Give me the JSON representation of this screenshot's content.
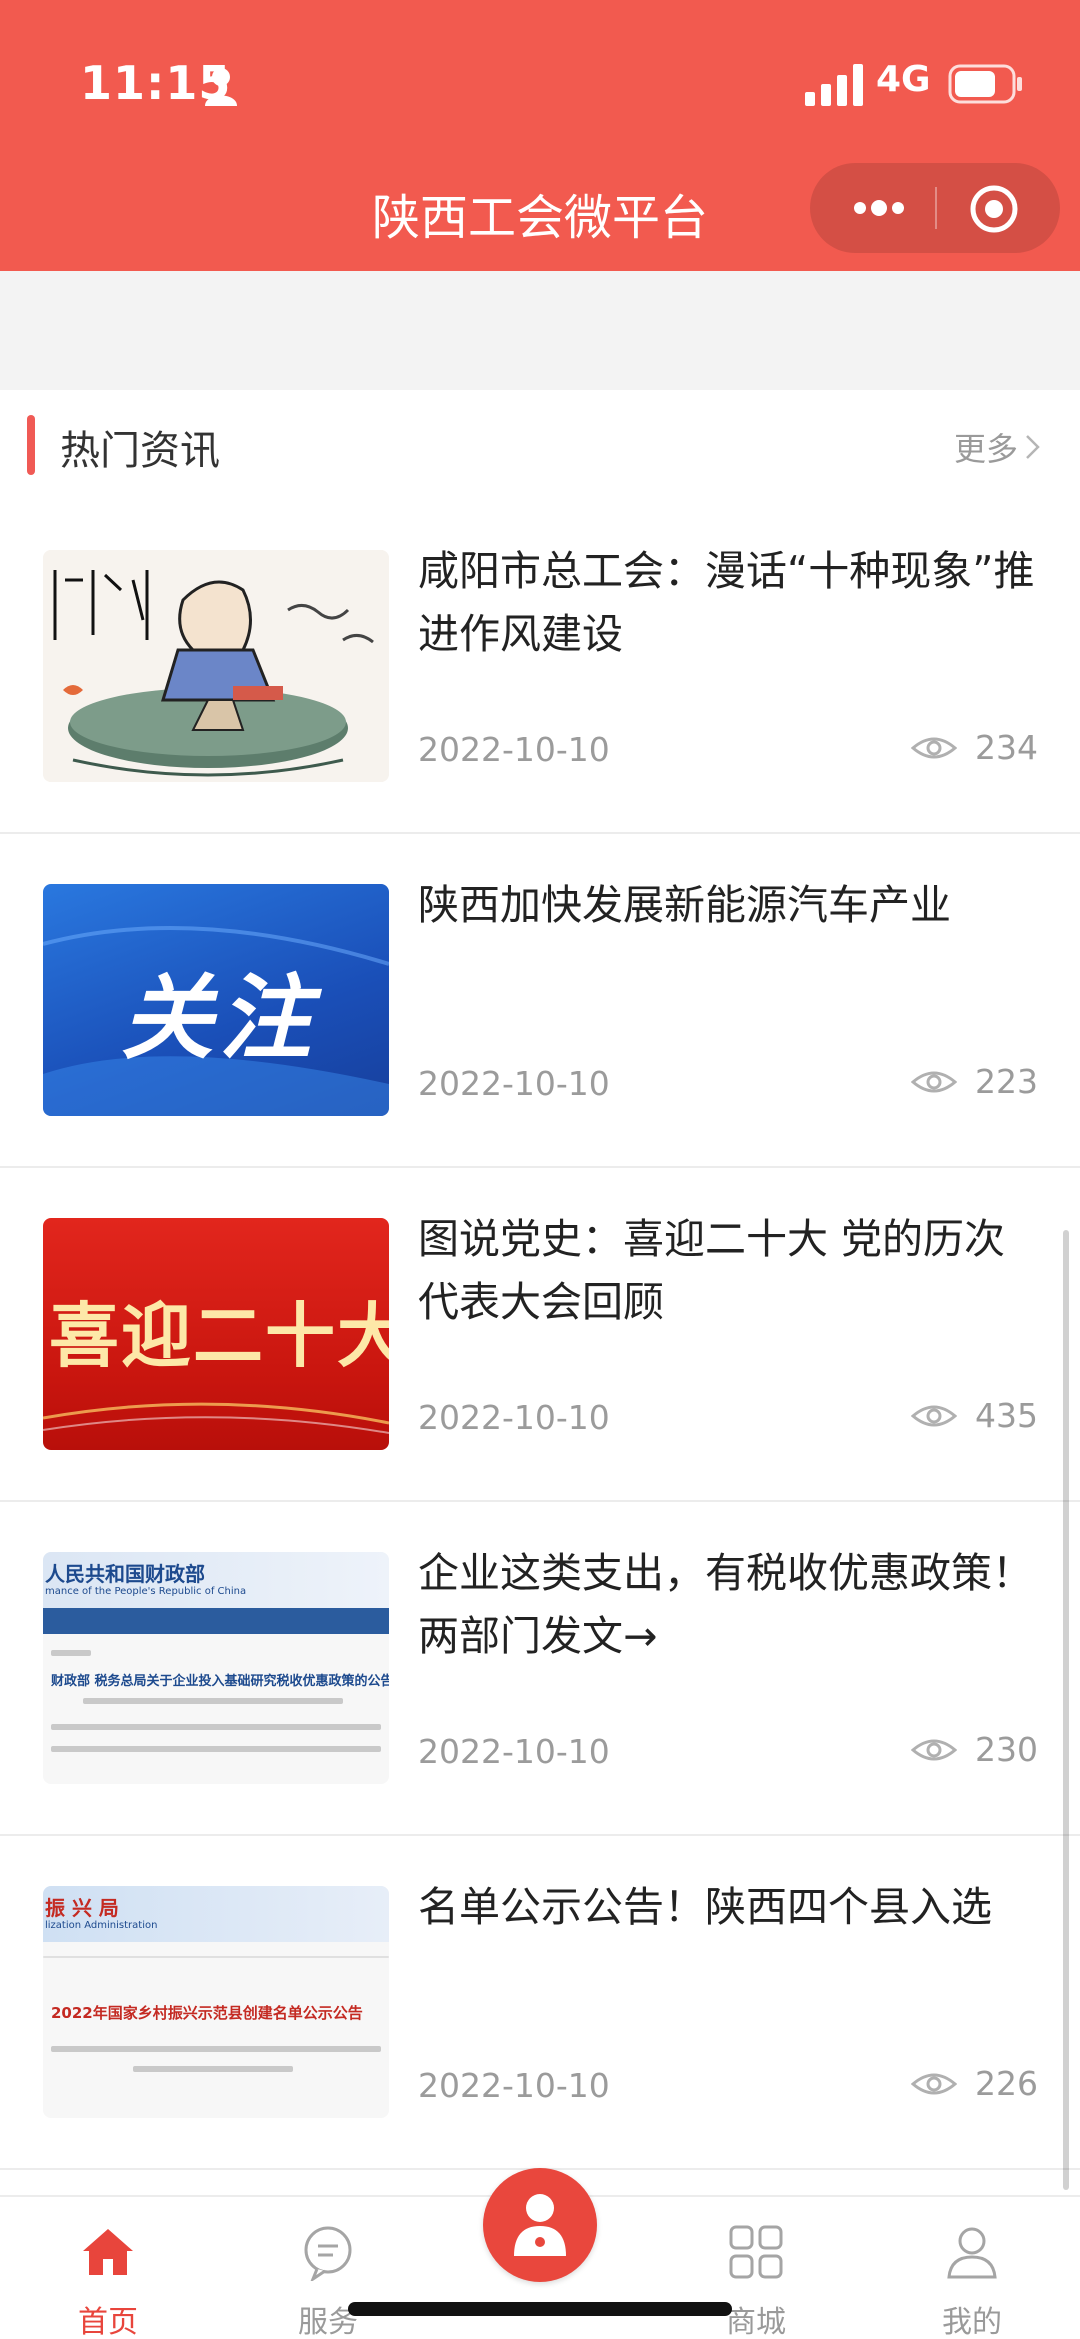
{
  "status_bar": {
    "time": "11:15",
    "network": "4G"
  },
  "header": {
    "title": "陕西工会微平台"
  },
  "section": {
    "title": "热门资讯",
    "more": "更多"
  },
  "news": [
    {
      "title": "咸阳市总工会：漫话“十种现象”推进作风建设",
      "date": "2022-10-10",
      "views": "234"
    },
    {
      "title": "陕西加快发展新能源汽车产业",
      "date": "2022-10-10",
      "views": "223"
    },
    {
      "title": "图说党史：喜迎二十大 党的历次代表大会回顾",
      "date": "2022-10-10",
      "views": "435"
    },
    {
      "title": "企业这类支出，有税收优惠政策！两部门发文→",
      "date": "2022-10-10",
      "views": "230"
    },
    {
      "title": "名单公示公告！陕西四个县入选",
      "date": "2022-10-10",
      "views": "226"
    }
  ],
  "thumbs": {
    "t2_text": "关注",
    "t3_text": "喜迎二十大",
    "t4_banner": "人民共和国财政部",
    "t4_banner_sub": "mance of the People's Republic of China",
    "t4_headline": "财政部 税务总局关于企业投入基础研究税收优惠政策的公告",
    "t5_banner": "振 兴 局",
    "t5_banner_sub": "lization Administration",
    "t5_headline": "2022年国家乡村振兴示范县创建名单公示公告"
  },
  "tabbar": {
    "items": [
      "首页",
      "服务",
      "商城",
      "我的"
    ],
    "active": "首页"
  },
  "colors": {
    "brand": "#f25a4f",
    "accent": "#e8453c"
  }
}
